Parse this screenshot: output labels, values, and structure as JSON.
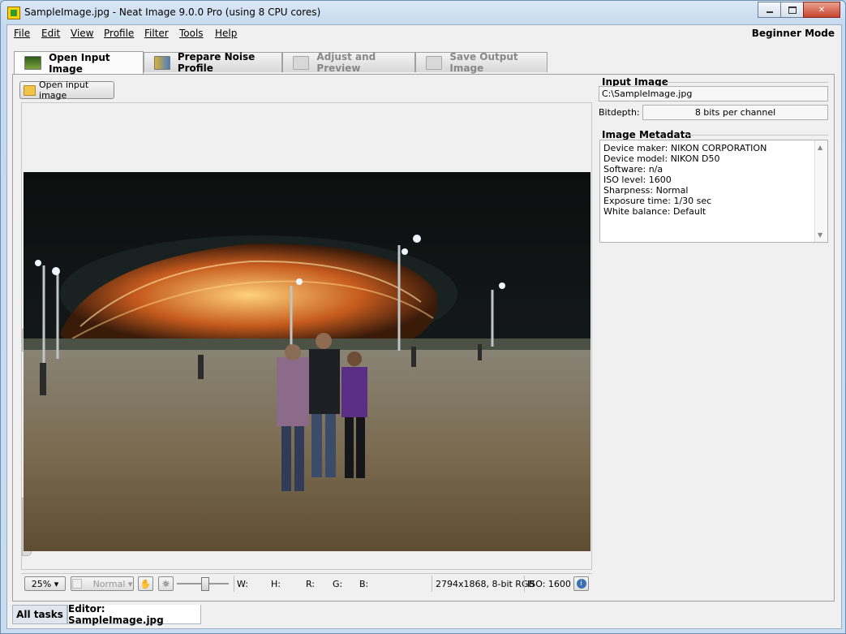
{
  "window": {
    "title": "SampleImage.jpg - Neat Image 9.0.0 Pro (using 8 CPU cores)"
  },
  "menu": {
    "items": [
      "File",
      "Edit",
      "View",
      "Profile",
      "Filter",
      "Tools",
      "Help"
    ],
    "mode": "Beginner Mode"
  },
  "steps": [
    {
      "label": "Open Input Image",
      "active": true
    },
    {
      "label": "Prepare Noise Profile",
      "active": false
    },
    {
      "label": "Adjust and Preview",
      "active": false
    },
    {
      "label": "Save Output Image",
      "active": false
    }
  ],
  "toolbar": {
    "open_button": "Open input image"
  },
  "statusbar": {
    "zoom": "25%",
    "view_mode": "Normal",
    "w_label": "W:",
    "h_label": "H:",
    "r_label": "R:",
    "g_label": "G:",
    "b_label": "B:",
    "image_info": "2794x1868, 8-bit RGB",
    "iso": "ISO: 1600"
  },
  "input_image": {
    "group_title": "Input Image",
    "path": "C:\\SampleImage.jpg",
    "bitdepth_label": "Bitdepth:",
    "bitdepth_value": "8 bits per channel"
  },
  "metadata": {
    "group_title": "Image Metadata",
    "lines": [
      "Device maker: NIKON CORPORATION",
      "Device model: NIKON D50",
      "Software: n/a",
      "ISO level: 1600",
      "Sharpness: Normal",
      "Exposure time: 1/30 sec",
      "White balance: Default"
    ]
  },
  "bottom_tabs": {
    "all_tasks": "All tasks",
    "editor": "Editor: SampleImage.jpg"
  }
}
